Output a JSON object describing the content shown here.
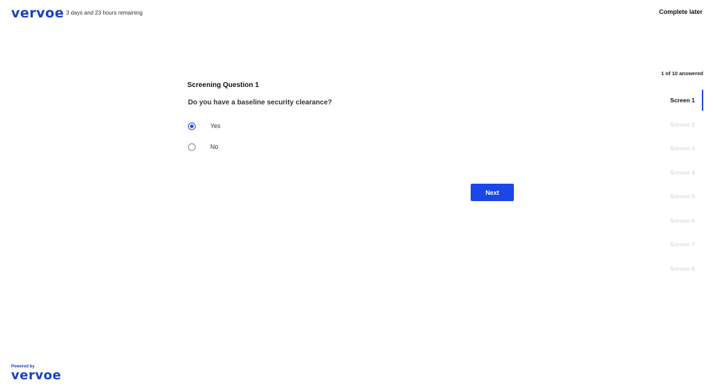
{
  "header": {
    "logo_text": "vervoe",
    "time_remaining": "3 days and 23 hours remaining",
    "complete_later": "Complete later"
  },
  "question": {
    "title": "Screening Question 1",
    "text": "Do you have a baseline security clearance?",
    "options": [
      {
        "label": "Yes",
        "selected": true
      },
      {
        "label": "No",
        "selected": false
      }
    ],
    "next_label": "Next"
  },
  "progress": {
    "text": "1 of 10 answered",
    "screens": [
      {
        "label": "Screen 1",
        "active": true
      },
      {
        "label": "Screen 2",
        "active": false
      },
      {
        "label": "Screen 3",
        "active": false
      },
      {
        "label": "Screen 4",
        "active": false
      },
      {
        "label": "Screen 5",
        "active": false
      },
      {
        "label": "Screen 6",
        "active": false
      },
      {
        "label": "Screen 7",
        "active": false
      },
      {
        "label": "Screen 8",
        "active": false
      }
    ]
  },
  "footer": {
    "powered_by": "Powered by",
    "logo_text": "vervoe"
  },
  "colors": {
    "brand_blue": "#1a3fc4",
    "accent_blue": "#1a47e6",
    "inactive_screen": "#dcdcdc"
  }
}
